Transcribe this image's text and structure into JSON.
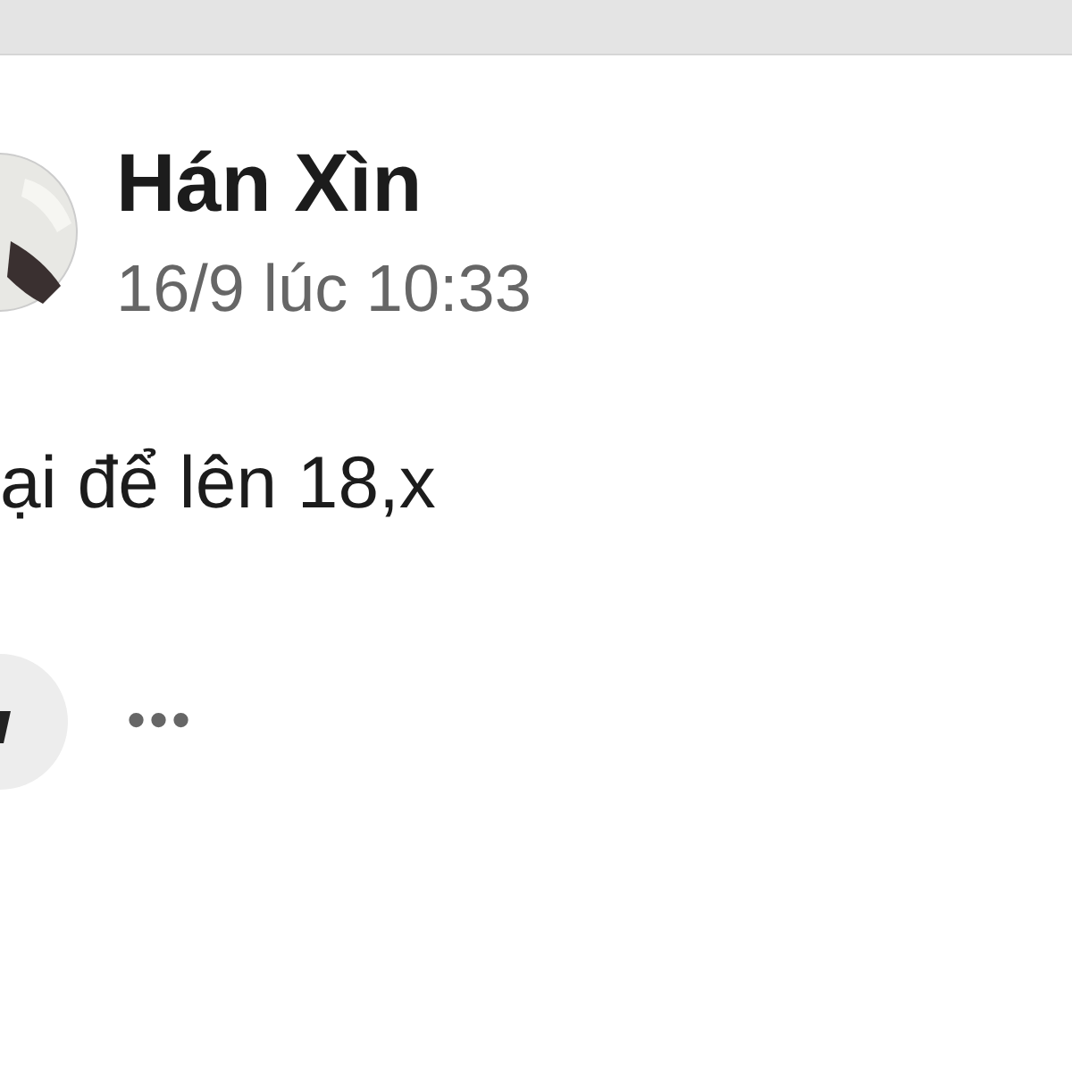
{
  "post": {
    "author": "Hán Xìn",
    "timestamp": "16/9 lúc 10:33",
    "text": "ại để lên 18,x"
  },
  "actions": {
    "more": "•••"
  }
}
